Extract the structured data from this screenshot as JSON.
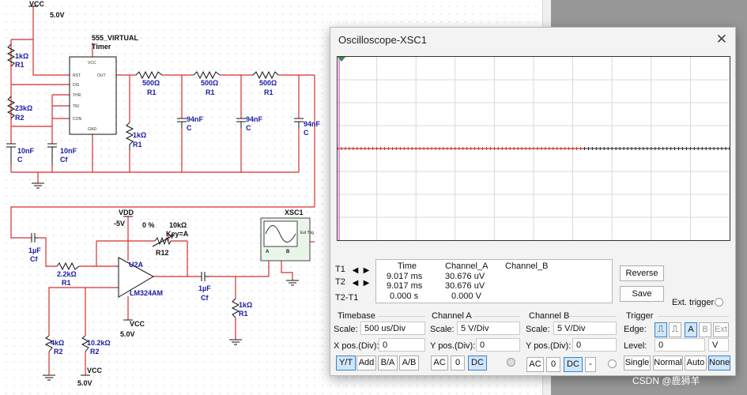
{
  "schematic": {
    "vcc_top": {
      "name": "VCC",
      "value": "5.0V"
    },
    "timer": {
      "title": "555_VIRTUAL",
      "subtitle": "Timer",
      "pins_left": [
        "RST",
        "DIS",
        "THR",
        "TRI",
        "CON"
      ],
      "pin_vcc": "VCC",
      "pin_out": "OUT",
      "pin_gnd": "GND"
    },
    "r1_top": {
      "value": "1kΩ",
      "ref": "R1"
    },
    "r2_top": {
      "value": "23kΩ",
      "ref": "R2"
    },
    "c_10nf_a": {
      "value": "10nF",
      "ref": "C"
    },
    "c_10nf_b": {
      "value": "10nF",
      "ref": "Cf"
    },
    "r_500_1": {
      "value": "500Ω",
      "ref": "R1"
    },
    "r_500_2": {
      "value": "500Ω",
      "ref": "R1"
    },
    "r_500_3": {
      "value": "500Ω",
      "ref": "R1"
    },
    "r_1k_mid": {
      "value": "1kΩ",
      "ref": "R1"
    },
    "c_94_1": {
      "value": "94nF",
      "ref": "C"
    },
    "c_94_2": {
      "value": "94nF",
      "ref": "C"
    },
    "c_94_3": {
      "value": "94nF",
      "ref": "C"
    },
    "c_in": {
      "value": "1µF",
      "ref": "Cf"
    },
    "r_22k": {
      "value": "2.2kΩ",
      "ref": "R1"
    },
    "vdd": {
      "name": "VDD",
      "value": "-5V"
    },
    "pot": {
      "percent": "0 %",
      "value": "10kΩ",
      "key": "Key=A",
      "ref": "R12"
    },
    "opamp": {
      "ref": "U2A",
      "model": "LM324AM"
    },
    "vcc_opamp": {
      "name": "VCC",
      "value": "5.0V"
    },
    "r_4k": {
      "value": "4kΩ",
      "ref": "R2"
    },
    "r_10k": {
      "value": "10.2kΩ",
      "ref": "R2"
    },
    "vcc_bottom": {
      "name": "VCC",
      "value": "5.0V"
    },
    "c_out": {
      "value": "1µF",
      "ref": "Cf"
    },
    "r_out": {
      "value": "1kΩ",
      "ref": "R1"
    },
    "xsc": {
      "ref": "XSC1",
      "ext_trig": "Ext Trig",
      "ch_a": "A",
      "ch_b": "B"
    }
  },
  "oscilloscope": {
    "title": "Oscilloscope-XSC1",
    "readout": {
      "headers": [
        "Time",
        "Channel_A",
        "Channel_B"
      ],
      "rows": [
        {
          "label": "T1",
          "time": "9.017 ms",
          "a": "30.676 uV",
          "b": ""
        },
        {
          "label": "T2",
          "time": "9.017 ms",
          "a": "30.676 uV",
          "b": ""
        },
        {
          "label": "T2-T1",
          "time": "0.000 s",
          "a": "0.000 V",
          "b": ""
        }
      ]
    },
    "buttons": {
      "reverse": "Reverse",
      "save": "Save",
      "ext_trigger": "Ext. trigger"
    },
    "timebase": {
      "title": "Timebase",
      "scale_label": "Scale:",
      "scale": "500 us/Div",
      "xpos_label": "X pos.(Div):",
      "xpos": "0",
      "modes": [
        "Y/T",
        "Add",
        "B/A",
        "A/B"
      ]
    },
    "channel_a": {
      "title": "Channel A",
      "scale_label": "Scale:",
      "scale": "5  V/Div",
      "ypos_label": "Y pos.(Div):",
      "ypos": "0",
      "coupling": [
        "AC",
        "0",
        "DC"
      ]
    },
    "channel_b": {
      "title": "Channel B",
      "scale_label": "Scale:",
      "scale": "5  V/Div",
      "ypos_label": "Y pos.(Div):",
      "ypos": "0",
      "coupling": [
        "AC",
        "0",
        "DC",
        "-"
      ]
    },
    "trigger": {
      "title": "Trigger",
      "edge_label": "Edge:",
      "sources": [
        "A",
        "B",
        "Ext"
      ],
      "level_label": "Level:",
      "level": "0",
      "level_unit": "V",
      "modes": [
        "Single",
        "Normal",
        "Auto",
        "None"
      ]
    },
    "trace_color": "#c0392b"
  },
  "watermark": "CSDN @鹿狮羊"
}
